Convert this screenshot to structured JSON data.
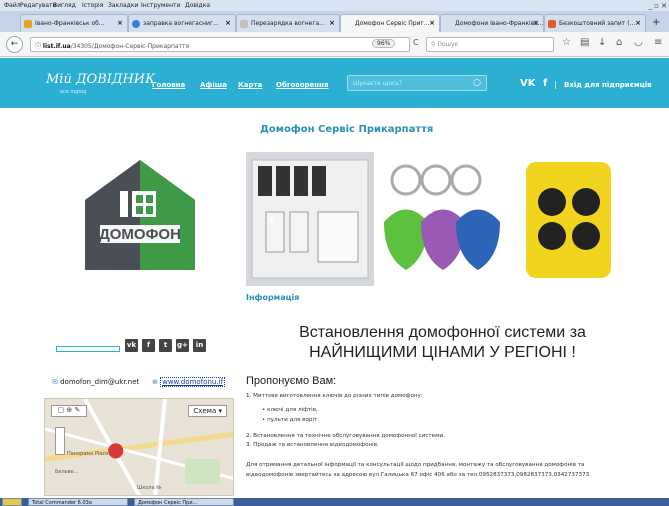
{
  "menubar": {
    "items": [
      "Файл",
      "Редагувати",
      "Вигляд",
      "Історія",
      "Закладки",
      "Інструменти",
      "Довідка"
    ]
  },
  "tabs": [
    {
      "title": "Івано-Франківськ об...",
      "color": "#e8a020"
    },
    {
      "title": "заправка вогнегасниг...",
      "color": "#3b7ddd"
    },
    {
      "title": "Перезарядка вогнега...",
      "color": "#c0c0c0"
    },
    {
      "title": "Домофон Сервіс Приг...",
      "color": "#2bb0d3"
    },
    {
      "title": "Домофони Івано-Франківс...",
      "color": "#2bb0d3"
    },
    {
      "title": "Безкоштовний запит (...",
      "color": "#e05d2b"
    }
  ],
  "navbar": {
    "url_domain": "list.if.ua",
    "url_path": "/34305/Домофон-Сервіс-Прикарпаття",
    "zoom": "96%",
    "search_placeholder": "Пошук"
  },
  "site": {
    "logo": "Мій ДОВІДНИК",
    "tagline": "все поряд",
    "nav": [
      "Головна",
      "Афіша",
      "Карта",
      "Обговорення"
    ],
    "search_placeholder": "Шукаєте щось?",
    "partners_link": "Вхід для підприємців"
  },
  "brand": {
    "name": "ДОМОФОН",
    "primary_color": "#3e9a46",
    "dark_color": "#4a4f55"
  },
  "contacts": {
    "email": "domofon_dim@ukr.net",
    "website": "www.domofonu.if"
  },
  "map": {
    "scheme_label": "Схема",
    "labels": [
      "Панорама Plaza",
      "Школа №",
      "Бельве..."
    ]
  },
  "main": {
    "title": "Домофон Сервіс Прикарпаття",
    "info_tab": "Інформація",
    "headline_line1": "Встановлення домофонної системи за",
    "headline_line2": "НАЙНИЩИМИ ЦІНАМИ У РЕГІОНІ !",
    "offer_heading": "Пропонуємо Вам:",
    "item1": "1. Миттєве виготовлення ключів до різних типів домофону:",
    "bullet1": "ключі для ліфтів,",
    "bullet2": "пульти для воріт.",
    "item2": "2. Встановлення та технічне обслуговування домофонної системи.",
    "item3": "3. Продаж та встановлення відеодомофонів.",
    "details_line1": "Для отримання детальної інформації та консультації щодо придбання, монтажу та обслуговування домофонів та",
    "details_line2": "відеодомофонів звертайтесь за адресою вул.Галицька 67 офіс 406 або за тел.0952837373,0982837373,0342737373"
  },
  "taskbar": {
    "items": [
      "Total Commander 6.03a",
      "Домофон Сервіс При..."
    ]
  }
}
